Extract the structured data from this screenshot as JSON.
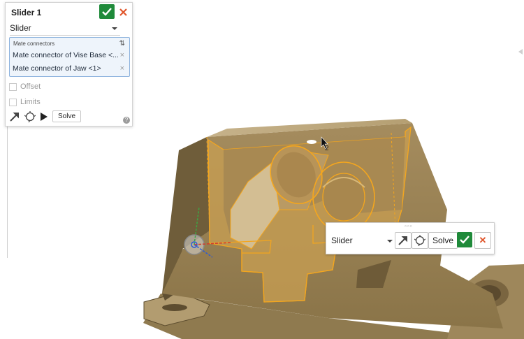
{
  "panel": {
    "title": "Slider 1",
    "mate_type": "Slider",
    "mate_connectors_label": "Mate connectors",
    "connectors": [
      {
        "label": "Mate connector of Vise Base <..."
      },
      {
        "label": "Mate connector of Jaw <1>"
      }
    ],
    "offset_label": "Offset",
    "limits_label": "Limits",
    "solve_label": "Solve",
    "help_glyph": "?",
    "remove_glyph": "×",
    "sort_glyph": "⇅"
  },
  "float_dialog": {
    "mate_type": "Slider",
    "solve_label": "Solve",
    "cancel_glyph": "✕"
  },
  "cursor_label": "2",
  "colors": {
    "accept_green": "#1f8a3a",
    "cancel_orange": "#e0562b",
    "part_tan": "#a88f63",
    "highlight_orange": "#f4a61e",
    "selection_blue": "#8fb4de"
  },
  "icons": [
    "check-icon",
    "close-icon",
    "sort-icon",
    "animate-icon",
    "mate-dof-icon",
    "play-icon",
    "help-icon",
    "grip-icon"
  ]
}
